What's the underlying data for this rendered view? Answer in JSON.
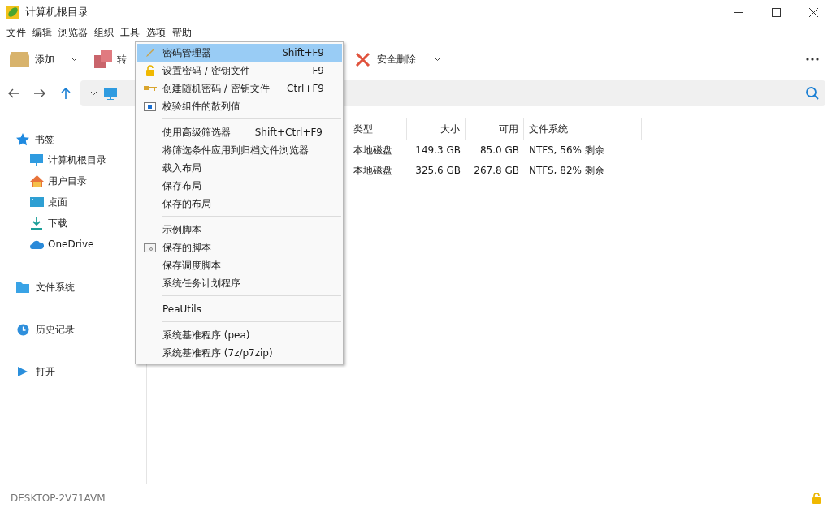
{
  "window": {
    "title": "计算机根目录"
  },
  "menubar": [
    "文件",
    "编辑",
    "浏览器",
    "组织",
    "工具",
    "选项",
    "帮助"
  ],
  "toolbar": {
    "add": "添加",
    "convert": "转",
    "delete": "安全删除"
  },
  "sidebar": {
    "bookmarks": "书签",
    "items": [
      "计算机根目录",
      "用户目录",
      "桌面",
      "下载",
      "OneDrive"
    ],
    "sections": [
      "文件系统",
      "历史记录",
      "打开"
    ]
  },
  "table": {
    "columns": [
      "类型",
      "大小",
      "可用",
      "文件系统"
    ],
    "rows": [
      [
        "本地磁盘",
        "149.3 GB",
        "85.0 GB",
        "NTFS, 56% 剩余"
      ],
      [
        "本地磁盘",
        "325.6 GB",
        "267.8 GB",
        "NTFS, 82% 剩余"
      ]
    ]
  },
  "tools_menu": {
    "groups": [
      [
        {
          "label": "密码管理器",
          "shortcut": "Shift+F9",
          "selected": true
        },
        {
          "label": "设置密码 / 密钥文件",
          "shortcut": "F9",
          "selected": false
        },
        {
          "label": "创建随机密码 / 密钥文件",
          "shortcut": "Ctrl+F9",
          "selected": false
        },
        {
          "label": "校验组件的散列值",
          "selected": false
        }
      ],
      [
        {
          "label": "使用高级筛选器",
          "shortcut": "Shift+Ctrl+F9",
          "selected": false
        },
        {
          "label": "将筛选条件应用到归档文件浏览器",
          "selected": false
        },
        {
          "label": "载入布局",
          "selected": false
        },
        {
          "label": "保存布局",
          "selected": false
        },
        {
          "label": "保存的布局",
          "selected": false
        }
      ],
      [
        {
          "label": "示例脚本",
          "selected": false
        },
        {
          "label": "保存的脚本",
          "selected": false
        },
        {
          "label": "保存调度脚本",
          "selected": false
        },
        {
          "label": "系统任务计划程序",
          "selected": false
        }
      ],
      [
        {
          "label": "PeaUtils",
          "selected": false
        }
      ],
      [
        {
          "label": "系统基准程序 (pea)",
          "selected": false
        },
        {
          "label": "系统基准程序 (7z/p7zip)",
          "selected": false
        }
      ]
    ]
  },
  "status_bar": {
    "computer": "DESKTOP-2V71AVM"
  }
}
